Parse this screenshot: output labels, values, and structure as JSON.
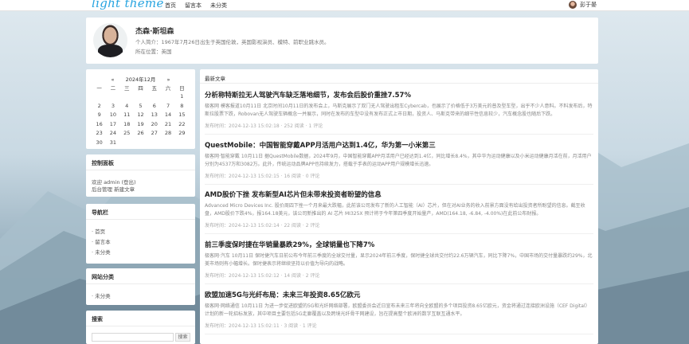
{
  "header": {
    "logo": "light theme",
    "nav": [
      "首页",
      "留言本",
      "未分类"
    ],
    "user_name": "彭于晏"
  },
  "profile": {
    "name": "杰森·斯坦森",
    "bio": "个人简介：1967年7月26日出生于英国伦敦，英国影视演员、模特、前职业跳水员。",
    "location": "所在位置：英国"
  },
  "calendar": {
    "prev": "«",
    "month": "2024年12月",
    "next": "»",
    "weekdays": [
      "一",
      "二",
      "三",
      "四",
      "五",
      "六",
      "日"
    ],
    "weeks": [
      [
        "",
        "",
        "",
        "",
        "",
        "",
        "1"
      ],
      [
        "2",
        "3",
        "4",
        "5",
        "6",
        "7",
        "8"
      ],
      [
        "9",
        "10",
        "11",
        "12",
        "13",
        "14",
        "15"
      ],
      [
        "16",
        "17",
        "18",
        "19",
        "20",
        "21",
        "22"
      ],
      [
        "23",
        "24",
        "25",
        "26",
        "27",
        "28",
        "29"
      ],
      [
        "30",
        "31",
        "",
        "",
        "",
        "",
        ""
      ]
    ]
  },
  "control_panel": {
    "title": "控制面板",
    "line1": "欢迎 admin (登出) ",
    "line2": "后台管理 新建文章"
  },
  "navbar": {
    "title": "导航栏",
    "items": [
      "· 首页",
      "· 留言本",
      "· 未分类"
    ]
  },
  "categories": {
    "title": "网站分类",
    "items": [
      "· 未分类"
    ]
  },
  "search": {
    "title": "搜索",
    "button": "搜索"
  },
  "main": {
    "title": "最新文章",
    "posts": [
      {
        "title": "分析称特斯拉无人驾驶汽车缺乏落地细节，发布会后股价重挫7.57%",
        "summary": "极客网 模客报道10月11日 北京时间10月11日的发布会上，马斯克展示了双门无人驾驶出租车Cybercab，也展示了价格低于3万美元的普及型车型，出乎不少人意料。不料发布后，特斯拉股票下跌，Robovan无人驾驶车辆概念一并展示，同时在发布的车型中没有发布正式上市日期，投资人、马斯克带来的细节性信息较少，汽车概念股也随后下跌。",
        "meta": "发布时间：2024-12-13 15:02:18 · 252 阅读 · 1 评论"
      },
      {
        "title": "QuestMobile：中国智能穿戴APP月活用户达到1.4亿，华为第一小米第三",
        "summary": "极客网·智能穿戴 10月11日 据QuestMobile数据，2024年9月，中国智能穿戴APP月活用户已经达到1.4亿，同比增长8.4%，其中华为运动健康以及小米运动健康月活在前，月活用户分别为4537万和3082万。此外，传统运动品牌APP也持续发力，搭载于手表的运动APP用户规模增长迅速。",
        "meta": "发布时间：2024-12-13 15:02:15 · 16 阅读 · 0 评论"
      },
      {
        "title": "AMD股价下挫 发布新型AI芯片但未带来投资者盼望的信息",
        "summary": "Advanced Micro Devices Inc. 股价周四下挫一个月来最大跌幅，此前该公司发布了新的人工智能（AI）芯片，但在对AI业务的收入前景方面没有给出投资者所盼望的信息。截至收盘，AMD股价下跌4%，报164.18美元，该公司新推出的 AI 芯片 MI325X 预计将于今年第四季度开始量产，AMD(164.18, -6.84, -4.00%)在此前公布财报。",
        "meta": "发布时间：2024-12-13 15:02:14 · 22 阅读 · 2 评论"
      },
      {
        "title": "前三季度保时捷在华销量暴跌29%，全球销量也下降7%",
        "summary": "极客网·汽车 10月11日 保时捷汽车日前公布今年前三季度的全球交付量，显示2024年前三季度，保时捷全球共交付约22.6万辆汽车，同比下降7%，中国市场的交付量暴跌约29%，北美市场则有小幅增长。保时捷表示将继续坚持以价值为导向的战略。",
        "meta": "发布时间：2024-12-13 15:02:12 · 14 阅读 · 2 评论"
      },
      {
        "title": "欧盟加速5G与光纤布局：未来三年投资8.65亿欧元",
        "summary": "极客网·网络通信 10月11日 为进一步促进欧盟的5G和光纤网络部署，欧盟委员会近日宣布未来三年将向全欧盟的多个项目投资8.65亿欧元，资金将通过连接欧洲设施（CEF Digital）计划的新一轮招标发放，其中项目主要包括5G走廊覆盖以及跨境光纤骨干网建设，旨在提高整个欧洲的数字互联互通水平。",
        "meta": "发布时间：2024-12-13 15:02:11 · 3 阅读 · 1 评论"
      }
    ]
  },
  "colors": {
    "logo": "#27a4e0",
    "card": "#ffffff"
  }
}
